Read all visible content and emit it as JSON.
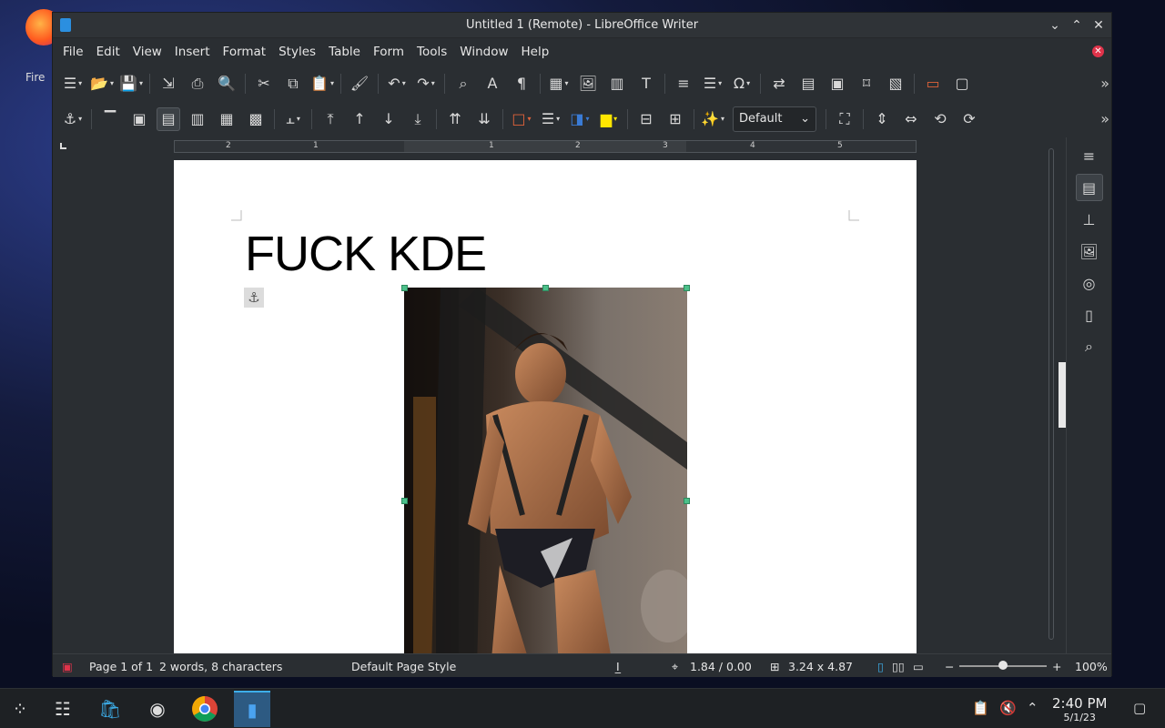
{
  "desktop": {
    "firefox_label": "Fire"
  },
  "window": {
    "title": "Untitled 1 (Remote) - LibreOffice Writer"
  },
  "menu": [
    "File",
    "Edit",
    "View",
    "Insert",
    "Format",
    "Styles",
    "Table",
    "Form",
    "Tools",
    "Window",
    "Help"
  ],
  "toolbar2": {
    "frame_style": "Default"
  },
  "ruler": {
    "labels": [
      "2",
      "1",
      "1",
      "2",
      "3",
      "4",
      "5"
    ]
  },
  "document": {
    "heading": "FUCK KDE"
  },
  "status": {
    "page": "Page 1 of 1",
    "words": "2 words, 8 characters",
    "page_style": "Default Page Style",
    "position": "1.84 / 0.00",
    "size": "3.24 x 4.87",
    "zoom": "100%"
  },
  "clock": {
    "time": "2:40 PM",
    "date": "5/1/23"
  },
  "colors": {
    "accent": "#3daee9",
    "handle": "#4cc08a",
    "close_doc": "#e0334a"
  }
}
